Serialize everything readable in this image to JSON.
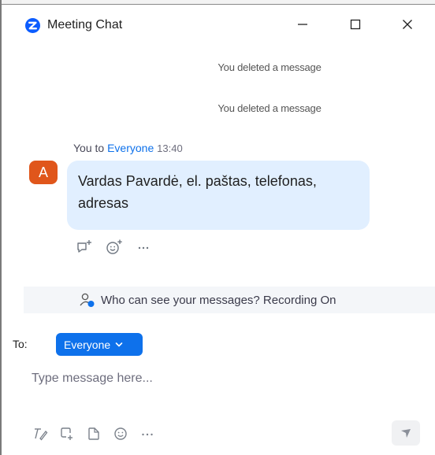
{
  "window": {
    "title": "Meeting Chat",
    "controls": {
      "minimize": "—",
      "maximize": "☐",
      "close": "✕"
    }
  },
  "system_messages": [
    "You deleted a message",
    "You deleted a message"
  ],
  "message": {
    "sender": "You to",
    "recipient": "Everyone",
    "time": "13:40",
    "avatar_letter": "A",
    "text": "Vardas Pavardė, el. paštas, telefonas, adresas",
    "actions": [
      "reply-thread-icon",
      "add-reaction-icon",
      "more-icon"
    ]
  },
  "privacy_notice": "Who can see your messages? Recording On",
  "composer": {
    "to_label": "To:",
    "recipient": "Everyone",
    "placeholder": "Type message here...",
    "tools": [
      "format-icon",
      "screenshot-icon",
      "file-icon",
      "emoji-icon",
      "more-icon"
    ]
  },
  "colors": {
    "accent": "#0e71eb",
    "bubble": "#e1efff",
    "avatar": "#e0561b",
    "zoom_logo": "#0b5cff"
  }
}
